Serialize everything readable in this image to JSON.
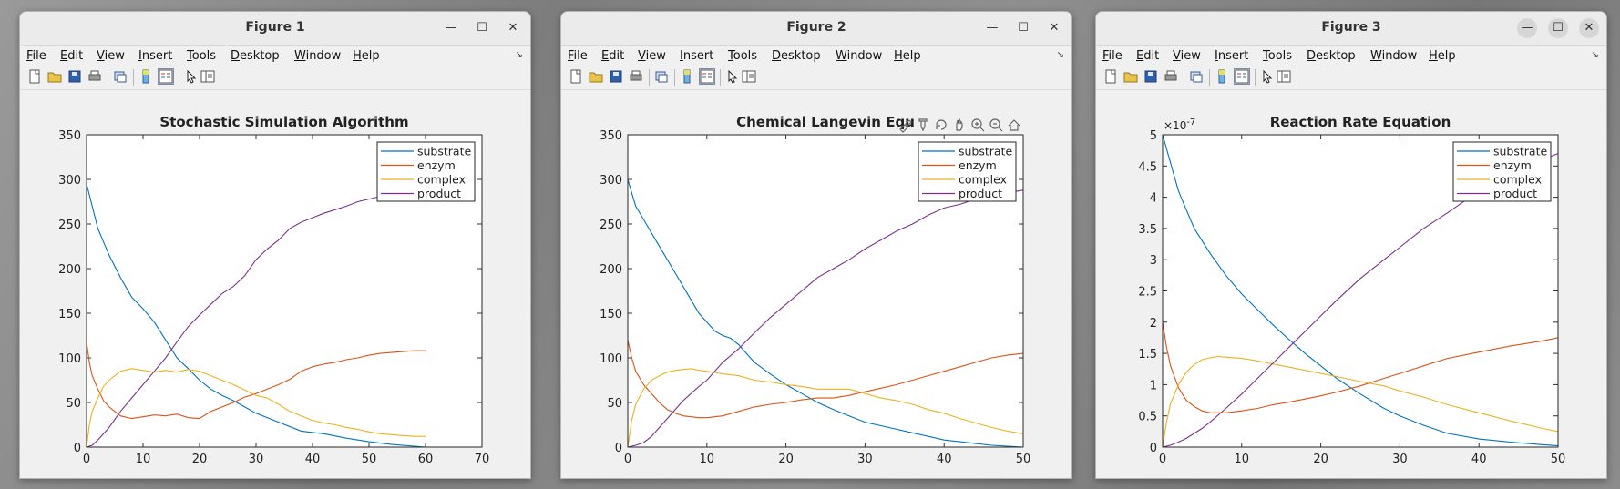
{
  "windows": [
    {
      "title": "Figure 1",
      "menu": [
        "File",
        "Edit",
        "View",
        "Insert",
        "Tools",
        "Desktop",
        "Window",
        "Help"
      ],
      "plot": {
        "title": "Stochastic Simulation Algorithm",
        "xlim": [
          0,
          70
        ],
        "ylim": [
          0,
          350
        ],
        "xticks": [
          "0",
          "10",
          "20",
          "30",
          "40",
          "50",
          "60",
          "70"
        ],
        "yticks": [
          "0",
          "50",
          "100",
          "150",
          "200",
          "250",
          "300",
          "350"
        ],
        "legend": [
          "substrate",
          "enzym",
          "complex",
          "product"
        ],
        "exponent": ""
      },
      "chart_data": {
        "type": "line",
        "title": "Stochastic Simulation Algorithm",
        "xlim": [
          0,
          70
        ],
        "ylim": [
          0,
          350
        ],
        "legend_position": "top-right",
        "grid": false,
        "series": [
          {
            "name": "substrate",
            "color": "#0072BD",
            "x": [
              0,
              1,
              2,
              4,
              6,
              8,
              10,
              12,
              14,
              16,
              18,
              20,
              22,
              24,
              26,
              28,
              30,
              34,
              38,
              42,
              46,
              50,
              54,
              58,
              60
            ],
            "y": [
              295,
              270,
              245,
              215,
              190,
              168,
              155,
              140,
              120,
              100,
              88,
              75,
              65,
              58,
              52,
              45,
              38,
              28,
              18,
              15,
              10,
              6,
              3,
              1,
              0
            ]
          },
          {
            "name": "enzym",
            "color": "#D95319",
            "x": [
              0,
              0.5,
              1,
              2,
              3,
              4,
              6,
              8,
              10,
              12,
              14,
              16,
              18,
              20,
              22,
              24,
              26,
              28,
              30,
              32,
              34,
              36,
              38,
              40,
              42,
              44,
              46,
              48,
              50,
              52,
              54,
              56,
              58,
              60
            ],
            "y": [
              118,
              95,
              80,
              65,
              52,
              45,
              35,
              32,
              34,
              36,
              35,
              37,
              33,
              32,
              40,
              45,
              50,
              56,
              60,
              65,
              70,
              76,
              85,
              90,
              93,
              95,
              98,
              100,
              103,
              105,
              106,
              107,
              108,
              108
            ]
          },
          {
            "name": "complex",
            "color": "#EDB120",
            "x": [
              0,
              0.5,
              1,
              2,
              3,
              4,
              6,
              8,
              10,
              12,
              14,
              16,
              18,
              20,
              22,
              24,
              26,
              28,
              30,
              32,
              34,
              36,
              38,
              40,
              42,
              44,
              46,
              48,
              50,
              52,
              54,
              56,
              58,
              60
            ],
            "y": [
              0,
              25,
              40,
              55,
              68,
              75,
              85,
              88,
              86,
              84,
              86,
              84,
              87,
              85,
              80,
              75,
              70,
              64,
              58,
              55,
              48,
              40,
              35,
              30,
              27,
              25,
              22,
              20,
              17,
              15,
              14,
              13,
              12,
              12
            ]
          },
          {
            "name": "product",
            "color": "#7E2F8E",
            "x": [
              0,
              1,
              2,
              4,
              6,
              8,
              10,
              12,
              14,
              16,
              18,
              20,
              22,
              24,
              26,
              28,
              30,
              32,
              34,
              36,
              38,
              40,
              42,
              44,
              46,
              48,
              50,
              52,
              54,
              56,
              58,
              60
            ],
            "y": [
              0,
              2,
              8,
              22,
              40,
              55,
              70,
              85,
              100,
              118,
              135,
              148,
              160,
              172,
              180,
              192,
              210,
              222,
              232,
              245,
              252,
              257,
              262,
              266,
              270,
              275,
              278,
              281,
              284,
              286,
              288,
              290
            ]
          }
        ]
      }
    },
    {
      "title": "Figure 2",
      "menu": [
        "File",
        "Edit",
        "View",
        "Insert",
        "Tools",
        "Desktop",
        "Window",
        "Help"
      ],
      "plot": {
        "title": "Chemical Langevin Equ",
        "xlim": [
          0,
          50
        ],
        "ylim": [
          0,
          350
        ],
        "xticks": [
          "0",
          "10",
          "20",
          "30",
          "40",
          "50"
        ],
        "yticks": [
          "0",
          "50",
          "100",
          "150",
          "200",
          "250",
          "300",
          "350"
        ],
        "legend": [
          "substrate",
          "enzym",
          "complex",
          "product"
        ],
        "exponent": ""
      },
      "chart_data": {
        "type": "line",
        "title": "Chemical Langevin Equ",
        "xlim": [
          0,
          50
        ],
        "ylim": [
          0,
          350
        ],
        "legend_position": "top-right",
        "grid": false,
        "series": [
          {
            "name": "substrate",
            "color": "#0072BD",
            "x": [
              0,
              0.5,
              1,
              2,
              3,
              4,
              5,
              6,
              7,
              8,
              9,
              10,
              11,
              12,
              13,
              14,
              15,
              16,
              18,
              20,
              22,
              24,
              26,
              28,
              30,
              32,
              34,
              36,
              38,
              40,
              42,
              44,
              46,
              48,
              50
            ],
            "y": [
              300,
              285,
              270,
              255,
              240,
              225,
              210,
              195,
              180,
              165,
              150,
              140,
              130,
              125,
              122,
              115,
              105,
              95,
              82,
              70,
              60,
              50,
              42,
              35,
              28,
              24,
              20,
              16,
              12,
              8,
              6,
              4,
              2,
              1,
              0
            ]
          },
          {
            "name": "enzym",
            "color": "#D95319",
            "x": [
              0,
              0.5,
              1,
              2,
              3,
              4,
              5,
              6,
              7,
              8,
              9,
              10,
              12,
              14,
              16,
              18,
              20,
              22,
              24,
              26,
              28,
              30,
              32,
              34,
              36,
              38,
              40,
              42,
              44,
              46,
              48,
              50
            ],
            "y": [
              120,
              100,
              85,
              70,
              60,
              50,
              42,
              38,
              35,
              34,
              33,
              33,
              35,
              40,
              45,
              48,
              50,
              53,
              55,
              55,
              58,
              62,
              66,
              70,
              75,
              80,
              85,
              90,
              95,
              100,
              103,
              105
            ]
          },
          {
            "name": "complex",
            "color": "#EDB120",
            "x": [
              0,
              0.5,
              1,
              2,
              3,
              4,
              5,
              6,
              7,
              8,
              9,
              10,
              12,
              14,
              16,
              18,
              20,
              22,
              24,
              26,
              28,
              30,
              32,
              34,
              36,
              38,
              40,
              42,
              44,
              46,
              48,
              50
            ],
            "y": [
              0,
              30,
              48,
              65,
              75,
              80,
              84,
              86,
              87,
              88,
              86,
              85,
              82,
              80,
              75,
              73,
              70,
              68,
              65,
              65,
              65,
              60,
              55,
              52,
              48,
              42,
              38,
              32,
              27,
              22,
              18,
              15
            ]
          },
          {
            "name": "product",
            "color": "#7E2F8E",
            "x": [
              0,
              1,
              2,
              3,
              4,
              5,
              6,
              7,
              8,
              9,
              10,
              11,
              12,
              14,
              16,
              18,
              20,
              22,
              24,
              26,
              28,
              30,
              32,
              34,
              36,
              38,
              40,
              42,
              44,
              46,
              48,
              50
            ],
            "y": [
              0,
              2,
              5,
              12,
              22,
              32,
              42,
              52,
              60,
              68,
              75,
              85,
              95,
              110,
              128,
              145,
              160,
              175,
              190,
              200,
              210,
              222,
              232,
              242,
              250,
              260,
              268,
              272,
              278,
              282,
              285,
              288
            ]
          }
        ]
      }
    },
    {
      "title": "Figure 3",
      "menu": [
        "File",
        "Edit",
        "View",
        "Insert",
        "Tools",
        "Desktop",
        "Window",
        "Help"
      ],
      "plot": {
        "title": "Reaction Rate Equation",
        "xlim": [
          0,
          50
        ],
        "ylim": [
          0,
          5
        ],
        "xticks": [
          "0",
          "10",
          "20",
          "30",
          "40",
          "50"
        ],
        "yticks": [
          "0",
          "0.5",
          "1",
          "1.5",
          "2",
          "2.5",
          "3",
          "3.5",
          "4",
          "4.5",
          "5"
        ],
        "legend": [
          "substrate",
          "enzym",
          "complex",
          "product"
        ],
        "exponent": "×10"
      },
      "exponent_power": "-7",
      "chart_data": {
        "type": "line",
        "title": "Reaction Rate Equation",
        "xlim": [
          0,
          50
        ],
        "ylim": [
          0,
          5
        ],
        "y_scale_factor": "1e-7",
        "legend_position": "top-right",
        "grid": false,
        "series": [
          {
            "name": "substrate",
            "color": "#0072BD",
            "x": [
              0,
              1,
              2,
              3,
              4,
              5,
              6,
              8,
              10,
              12,
              14,
              16,
              18,
              20,
              22,
              25,
              28,
              30,
              33,
              36,
              40,
              44,
              48,
              50
            ],
            "y": [
              5.0,
              4.55,
              4.1,
              3.8,
              3.5,
              3.3,
              3.1,
              2.75,
              2.45,
              2.2,
              1.95,
              1.72,
              1.5,
              1.3,
              1.1,
              0.85,
              0.62,
              0.5,
              0.35,
              0.22,
              0.13,
              0.08,
              0.04,
              0.02
            ]
          },
          {
            "name": "enzym",
            "color": "#D95319",
            "x": [
              0,
              0.5,
              1,
              2,
              3,
              4,
              5,
              6,
              8,
              10,
              12,
              14,
              16,
              18,
              20,
              22,
              25,
              28,
              30,
              33,
              36,
              40,
              44,
              48,
              50
            ],
            "y": [
              2.0,
              1.6,
              1.3,
              0.95,
              0.75,
              0.65,
              0.58,
              0.55,
              0.55,
              0.58,
              0.62,
              0.68,
              0.72,
              0.77,
              0.82,
              0.88,
              0.98,
              1.1,
              1.18,
              1.3,
              1.42,
              1.52,
              1.62,
              1.7,
              1.75
            ]
          },
          {
            "name": "complex",
            "color": "#EDB120",
            "x": [
              0,
              0.5,
              1,
              2,
              3,
              4,
              5,
              6,
              7,
              8,
              10,
              12,
              14,
              16,
              18,
              20,
              22,
              25,
              28,
              30,
              33,
              36,
              40,
              44,
              48,
              50
            ],
            "y": [
              0,
              0.4,
              0.7,
              1.0,
              1.2,
              1.32,
              1.4,
              1.43,
              1.45,
              1.44,
              1.42,
              1.38,
              1.33,
              1.28,
              1.23,
              1.18,
              1.13,
              1.05,
              0.98,
              0.9,
              0.8,
              0.68,
              0.55,
              0.42,
              0.3,
              0.25
            ]
          },
          {
            "name": "product",
            "color": "#7E2F8E",
            "x": [
              0,
              1,
              2,
              3,
              4,
              5,
              6,
              8,
              10,
              12,
              14,
              16,
              18,
              20,
              22,
              25,
              28,
              30,
              33,
              36,
              40,
              44,
              48,
              50
            ],
            "y": [
              0,
              0.03,
              0.08,
              0.14,
              0.22,
              0.3,
              0.4,
              0.62,
              0.85,
              1.1,
              1.35,
              1.6,
              1.85,
              2.1,
              2.35,
              2.7,
              3.0,
              3.2,
              3.5,
              3.75,
              4.1,
              4.35,
              4.6,
              4.7
            ]
          }
        ]
      }
    }
  ]
}
